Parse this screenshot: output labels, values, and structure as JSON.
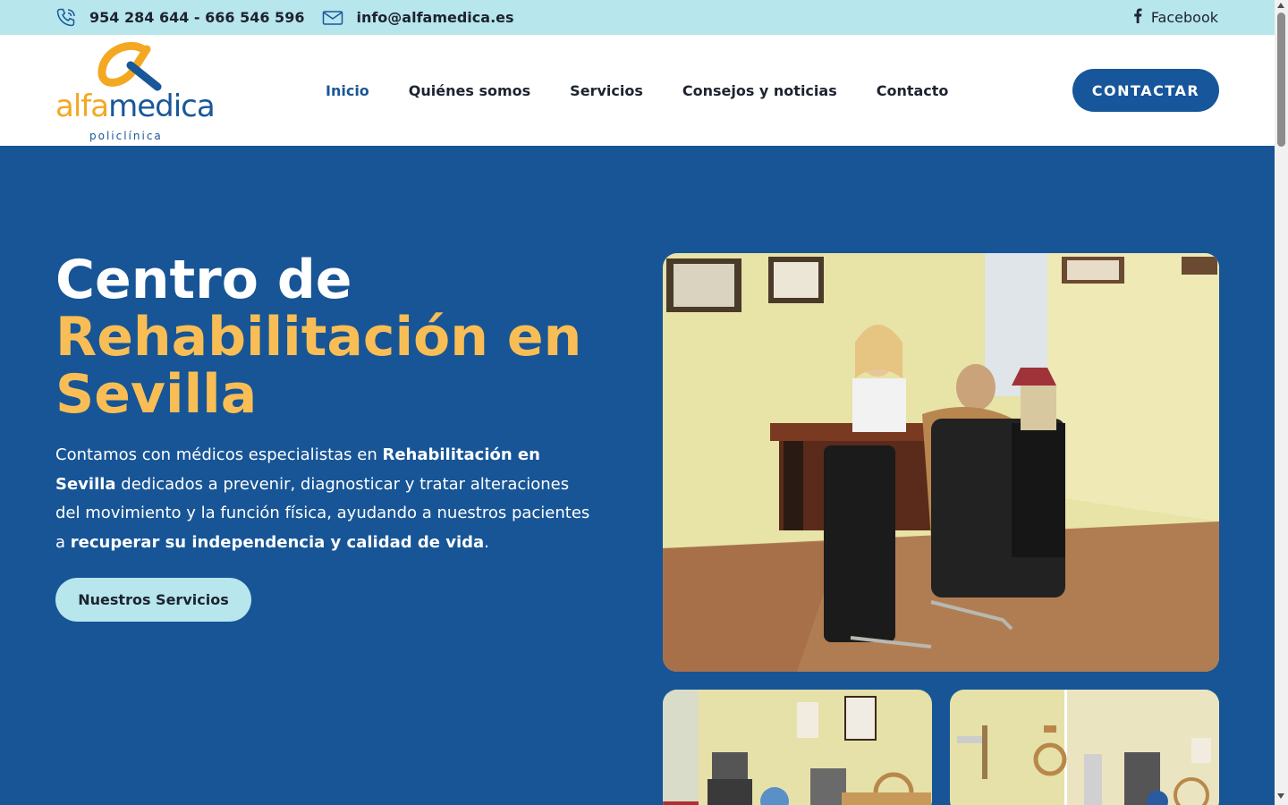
{
  "topbar": {
    "phone": "954 284 644 - 666 546 596",
    "email": "info@alfamedica.es",
    "facebook": "Facebook",
    "phone_icon": "phone-icon",
    "email_icon": "envelope-icon",
    "facebook_icon": "facebook-icon"
  },
  "logo": {
    "word_a": "alfa",
    "word_b": "medica",
    "sub": "policlínica"
  },
  "nav": {
    "items": [
      "Inicio",
      "Quiénes somos",
      "Servicios",
      "Consejos y noticias",
      "Contacto"
    ],
    "active": "Inicio",
    "cta": "CONTACTAR"
  },
  "hero": {
    "title_line1": "Centro de",
    "title_highlight": "Rehabilitación en Sevilla",
    "desc_1": "Contamos con médicos especialistas en ",
    "desc_2": "Rehabilitación en Sevilla",
    "desc_3": " dedicados a prevenir, diagnosticar y tratar alteraciones del movimiento y la función física, ayudando a nuestros pacientes a ",
    "desc_4": "recuperar su independencia y calidad de vida",
    "desc_5": ".",
    "button": "Nuestros Servicios"
  },
  "colors": {
    "topbar_bg": "#b7e6ec",
    "primary": "#175596",
    "accent": "#f8be55",
    "brand_orange": "#f4a822",
    "brand_blue": "#1a5798",
    "text_dark": "#1d2330"
  }
}
